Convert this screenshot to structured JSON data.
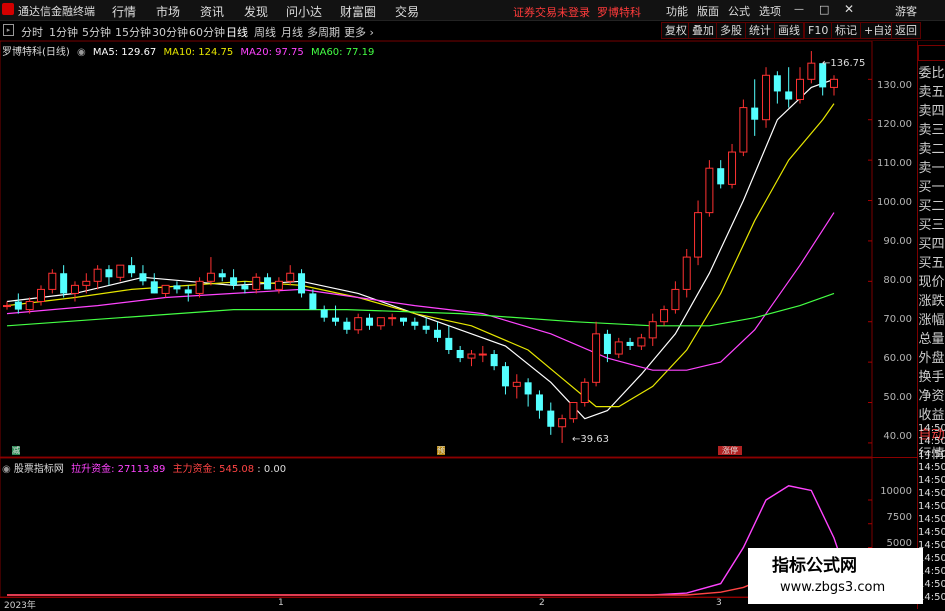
{
  "app": {
    "title": "通达信金融终端"
  },
  "menu": [
    "行情",
    "市场",
    "资讯",
    "发现",
    "问小达",
    "财富圈",
    "交易"
  ],
  "notice": "证券交易未登录",
  "stock_name": "罗博特科",
  "right_menu": [
    "功能",
    "版面",
    "公式",
    "选项"
  ],
  "guest": "游客",
  "periods": [
    "分时",
    "1分钟",
    "5分钟",
    "15分钟",
    "30分钟",
    "60分钟",
    "日线",
    "周线",
    "月线",
    "多周期",
    "更多"
  ],
  "toolbar_buttons": [
    "复权",
    "叠加",
    "多股",
    "统计",
    "画线",
    "F10",
    "标记",
    "+自选",
    "返回"
  ],
  "chart_header": {
    "title": "罗博特科(日线)",
    "ma": [
      {
        "label": "MA5: 129.67",
        "color": "#ffffff"
      },
      {
        "label": "MA10: 124.75",
        "color": "#e6e600"
      },
      {
        "label": "MA20: 97.75",
        "color": "#ff44ff"
      },
      {
        "label": "MA60: 77.19",
        "color": "#44ff44"
      }
    ]
  },
  "sidebar": [
    "委比",
    "卖五",
    "卖四",
    "卖三",
    "卖二",
    "卖一",
    "买一",
    "买二",
    "买三",
    "买四",
    "买五",
    "现价",
    "涨跌",
    "涨幅",
    "总量",
    "外盘",
    "换手",
    "净资",
    "收益",
    "自动",
    "行情"
  ],
  "price_axis": [
    "130.00",
    "120.00",
    "110.00",
    "100.00",
    "90.00",
    "80.00",
    "70.00",
    "60.00",
    "50.00",
    "40.00"
  ],
  "ind_axis": [
    "10000",
    "7500",
    "5000",
    "2500"
  ],
  "time_labels": [
    "14:50",
    "14:50",
    "14:50",
    "14:50",
    "14:50",
    "14:50",
    "14:50",
    "14:50",
    "14:50",
    "14:50",
    "14:50",
    "14:50",
    "14:50",
    "14:50",
    "14:50",
    "14:50",
    "14:50",
    "14:50",
    "14:50"
  ],
  "annotations": {
    "high": "136.75",
    "low": "39.63"
  },
  "markers": [
    "减",
    "预",
    "涨停"
  ],
  "indicator": {
    "name": "股票指标网",
    "funds": [
      {
        "label": "拉升资金: 27113.89",
        "color": "#ff44ff"
      },
      {
        "label": "主力资金: 545.08",
        "color": "#ff4444"
      },
      {
        "label": ": 0.00",
        "color": "#dddddd"
      }
    ]
  },
  "date_axis": [
    "2023年",
    "1",
    "2",
    "3"
  ],
  "watermark": {
    "title": "指标公式网",
    "url": "www.zbgs3.com"
  },
  "chart_data": [
    {
      "type": "candlestick",
      "title": "罗博特科(日线)",
      "ylim": [
        38,
        138
      ],
      "candles": [
        [
          74,
          75,
          73,
          74
        ],
        [
          75,
          77,
          72,
          73
        ],
        [
          73,
          76,
          72,
          75
        ],
        [
          75,
          79,
          74,
          78
        ],
        [
          78,
          83,
          77,
          82
        ],
        [
          82,
          84,
          76,
          77
        ],
        [
          77,
          80,
          75,
          79
        ],
        [
          79,
          82,
          77,
          80
        ],
        [
          80,
          84,
          78,
          83
        ],
        [
          83,
          84,
          79,
          81
        ],
        [
          81,
          84,
          80,
          84
        ],
        [
          84,
          86,
          81,
          82
        ],
        [
          82,
          84,
          79,
          80
        ],
        [
          80,
          82,
          77,
          77
        ],
        [
          77,
          79,
          76,
          79
        ],
        [
          79,
          80,
          77,
          78
        ],
        [
          78,
          79,
          75,
          77
        ],
        [
          77,
          81,
          76,
          80
        ],
        [
          80,
          86,
          79,
          82
        ],
        [
          82,
          83,
          80,
          81
        ],
        [
          81,
          83,
          78,
          79
        ],
        [
          79,
          80,
          77,
          78
        ],
        [
          78,
          82,
          77,
          81
        ],
        [
          81,
          82,
          78,
          78
        ],
        [
          78,
          81,
          77,
          80
        ],
        [
          80,
          84,
          79,
          82
        ],
        [
          82,
          83,
          76,
          77
        ],
        [
          77,
          78,
          73,
          73
        ],
        [
          73,
          74,
          70,
          71
        ],
        [
          71,
          74,
          69,
          70
        ],
        [
          70,
          71,
          67,
          68
        ],
        [
          68,
          72,
          67,
          71
        ],
        [
          71,
          72,
          68,
          69
        ],
        [
          69,
          71,
          68,
          71
        ],
        [
          71,
          72,
          69,
          71
        ],
        [
          71,
          71,
          69,
          70
        ],
        [
          70,
          71,
          68,
          69
        ],
        [
          69,
          71,
          67,
          68
        ],
        [
          68,
          70,
          65,
          66
        ],
        [
          66,
          69,
          62,
          63
        ],
        [
          63,
          64,
          60,
          61
        ],
        [
          61,
          63,
          59,
          62
        ],
        [
          62,
          64,
          60,
          62
        ],
        [
          62,
          63,
          58,
          59
        ],
        [
          59,
          60,
          52,
          54
        ],
        [
          54,
          57,
          51,
          55
        ],
        [
          55,
          56,
          49,
          52
        ],
        [
          52,
          53,
          46,
          48
        ],
        [
          48,
          50,
          42,
          44
        ],
        [
          44,
          47,
          40,
          46
        ],
        [
          46,
          50,
          45,
          50
        ],
        [
          50,
          56,
          49,
          55
        ],
        [
          55,
          70,
          54,
          67
        ],
        [
          67,
          68,
          60,
          62
        ],
        [
          62,
          66,
          61,
          65
        ],
        [
          65,
          66,
          63,
          64
        ],
        [
          64,
          67,
          63,
          66
        ],
        [
          66,
          72,
          64,
          70
        ],
        [
          70,
          74,
          69,
          73
        ],
        [
          73,
          80,
          72,
          78
        ],
        [
          78,
          88,
          76,
          86
        ],
        [
          86,
          100,
          84,
          97
        ],
        [
          97,
          110,
          96,
          108
        ],
        [
          108,
          110,
          103,
          104
        ],
        [
          104,
          114,
          103,
          112
        ],
        [
          112,
          125,
          111,
          123
        ],
        [
          123,
          130,
          116,
          120
        ],
        [
          120,
          133,
          118,
          131
        ],
        [
          131,
          132,
          124,
          127
        ],
        [
          127,
          133,
          123,
          125
        ],
        [
          125,
          133,
          124,
          130
        ],
        [
          130,
          137,
          129,
          134
        ],
        [
          134,
          134,
          126,
          128
        ],
        [
          128,
          131,
          126,
          130
        ]
      ],
      "series": [
        {
          "name": "MA5",
          "color": "#ffffff",
          "values": [
            [
              0,
              75
            ],
            [
              6,
              77
            ],
            [
              9,
              79
            ],
            [
              12,
              81
            ],
            [
              16,
              80
            ],
            [
              20,
              79
            ],
            [
              26,
              80
            ],
            [
              31,
              77
            ],
            [
              36,
              72
            ],
            [
              40,
              68
            ],
            [
              44,
              64
            ],
            [
              48,
              55
            ],
            [
              51,
              46
            ],
            [
              53,
              48
            ],
            [
              56,
              57
            ],
            [
              59,
              67
            ],
            [
              62,
              82
            ],
            [
              65,
              100
            ],
            [
              68,
              120
            ],
            [
              71,
              128
            ],
            [
              73,
              130
            ]
          ]
        },
        {
          "name": "MA10",
          "color": "#e6e600",
          "values": [
            [
              0,
              74
            ],
            [
              6,
              76
            ],
            [
              11,
              78
            ],
            [
              16,
              79
            ],
            [
              21,
              80
            ],
            [
              26,
              79
            ],
            [
              31,
              76
            ],
            [
              36,
              72
            ],
            [
              41,
              69
            ],
            [
              46,
              63
            ],
            [
              49,
              56
            ],
            [
              52,
              49
            ],
            [
              54,
              49
            ],
            [
              57,
              54
            ],
            [
              60,
              63
            ],
            [
              63,
              77
            ],
            [
              66,
              95
            ],
            [
              69,
              110
            ],
            [
              72,
              120
            ],
            [
              73,
              124
            ]
          ]
        },
        {
          "name": "MA20",
          "color": "#ff44ff",
          "values": [
            [
              0,
              72
            ],
            [
              8,
              74
            ],
            [
              14,
              76
            ],
            [
              20,
              77
            ],
            [
              26,
              78
            ],
            [
              31,
              76
            ],
            [
              36,
              74
            ],
            [
              42,
              72
            ],
            [
              48,
              67
            ],
            [
              53,
              61
            ],
            [
              57,
              58
            ],
            [
              60,
              58
            ],
            [
              63,
              60
            ],
            [
              66,
              68
            ],
            [
              70,
              84
            ],
            [
              73,
              97
            ]
          ]
        },
        {
          "name": "MA60",
          "color": "#44ff44",
          "values": [
            [
              0,
              69
            ],
            [
              10,
              71
            ],
            [
              20,
              73
            ],
            [
              30,
              73
            ],
            [
              40,
              72
            ],
            [
              50,
              70
            ],
            [
              57,
              69
            ],
            [
              62,
              69
            ],
            [
              66,
              71
            ],
            [
              70,
              74
            ],
            [
              73,
              77
            ]
          ]
        }
      ]
    },
    {
      "type": "line",
      "ylim": [
        0,
        14000
      ],
      "series": [
        {
          "name": "拉升资金",
          "color": "#ff44ff",
          "values": [
            [
              0,
              0
            ],
            [
              57,
              0
            ],
            [
              60,
              200
            ],
            [
              63,
              1200
            ],
            [
              65,
              5000
            ],
            [
              67,
              10000
            ],
            [
              69,
              11500
            ],
            [
              71,
              11000
            ],
            [
              73,
              6000
            ],
            [
              74,
              2500
            ]
          ]
        },
        {
          "name": "主力资金",
          "color": "#ff4444",
          "values": [
            [
              0,
              0
            ],
            [
              60,
              0
            ],
            [
              63,
              300
            ],
            [
              65,
              800
            ],
            [
              67,
              1800
            ],
            [
              69,
              900
            ],
            [
              71,
              300
            ],
            [
              74,
              150
            ]
          ]
        }
      ]
    }
  ]
}
